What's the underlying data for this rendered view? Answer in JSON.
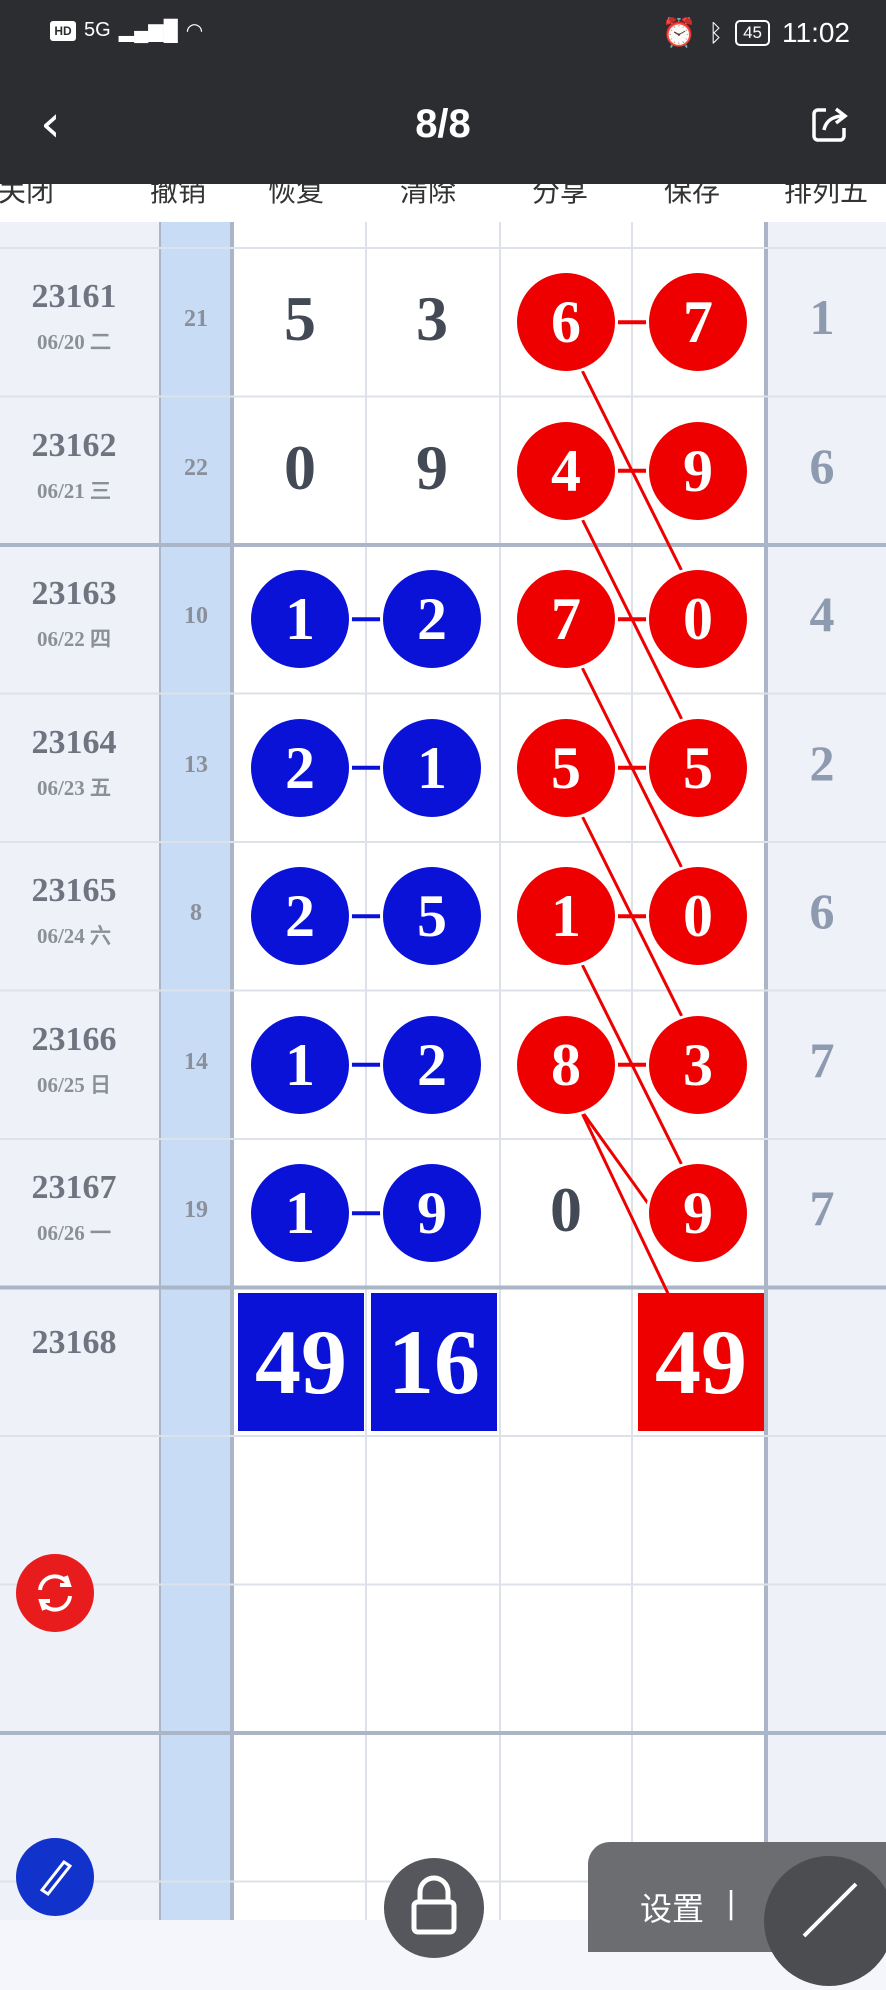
{
  "status_bar": {
    "network": "5G",
    "battery": "45",
    "time": "11:02"
  },
  "nav": {
    "title": "8/8"
  },
  "headers": [
    "关闭",
    "撤销",
    "恢复",
    "清除",
    "分享",
    "保存",
    "排列五"
  ],
  "rows": [
    {
      "issue": "23161",
      "date": "06/20 二",
      "count": "21",
      "a": "5",
      "b": "3",
      "c": "6",
      "d": "7",
      "last": "1",
      "ab_style": "plain",
      "c_style": "red",
      "d_style": "red"
    },
    {
      "issue": "23162",
      "date": "06/21 三",
      "count": "22",
      "a": "0",
      "b": "9",
      "c": "4",
      "d": "9",
      "last": "6",
      "ab_style": "plain",
      "c_style": "red",
      "d_style": "red"
    },
    {
      "issue": "23163",
      "date": "06/22 四",
      "count": "10",
      "a": "1",
      "b": "2",
      "c": "7",
      "d": "0",
      "last": "4",
      "ab_style": "blue",
      "c_style": "red",
      "d_style": "red"
    },
    {
      "issue": "23164",
      "date": "06/23 五",
      "count": "13",
      "a": "2",
      "b": "1",
      "c": "5",
      "d": "5",
      "last": "2",
      "ab_style": "blue",
      "c_style": "red",
      "d_style": "red"
    },
    {
      "issue": "23165",
      "date": "06/24 六",
      "count": "8",
      "a": "2",
      "b": "5",
      "c": "1",
      "d": "0",
      "last": "6",
      "ab_style": "blue",
      "c_style": "red",
      "d_style": "red"
    },
    {
      "issue": "23166",
      "date": "06/25 日",
      "count": "14",
      "a": "1",
      "b": "2",
      "c": "8",
      "d": "3",
      "last": "7",
      "ab_style": "blue",
      "c_style": "red",
      "d_style": "red"
    },
    {
      "issue": "23167",
      "date": "06/26 一",
      "count": "19",
      "a": "1",
      "b": "9",
      "c": "0",
      "d": "9",
      "last": "7",
      "ab_style": "blue",
      "c_style": "plain",
      "d_style": "red"
    }
  ],
  "prediction": {
    "issue": "23168",
    "a": "49",
    "b": "16",
    "d": "49"
  },
  "toolbar": {
    "settings_label": "设置",
    "separator": "|"
  },
  "colors": {
    "blue": "#0a12d8",
    "red": "#ee0000",
    "count_column": "#c8dcf6",
    "header_bg": "#2c2d30"
  }
}
